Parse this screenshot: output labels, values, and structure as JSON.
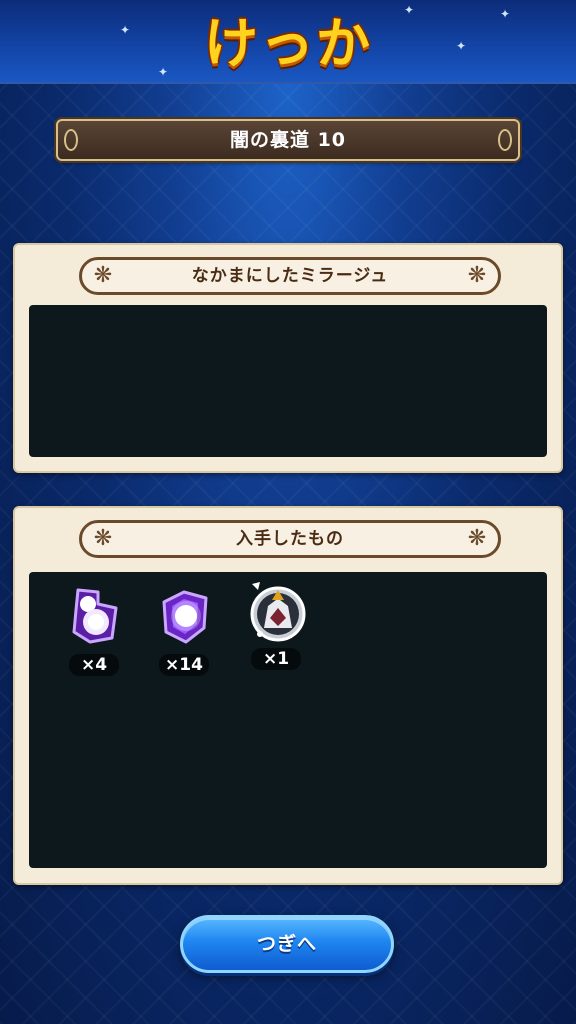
{
  "header": {
    "title": "けっか"
  },
  "stage": {
    "name": "闇の裏道 10"
  },
  "sections": {
    "recruited": {
      "title": "なかまにしたミラージュ"
    },
    "obtained": {
      "title": "入手したもの",
      "items": [
        {
          "icon": "purple-spirit-orb-icon",
          "quantity": "×4"
        },
        {
          "icon": "purple-crystal-icon",
          "quantity": "×14"
        },
        {
          "icon": "armored-mirage-medal-icon",
          "quantity": "×1"
        }
      ]
    }
  },
  "buttons": {
    "next_label": "つぎへ"
  },
  "colors": {
    "background": "#0a2a6c",
    "title_text": "#ffd21f",
    "panel": "#f4ecd8",
    "panel_body": "#0c181b",
    "button": "#1f86f0"
  }
}
